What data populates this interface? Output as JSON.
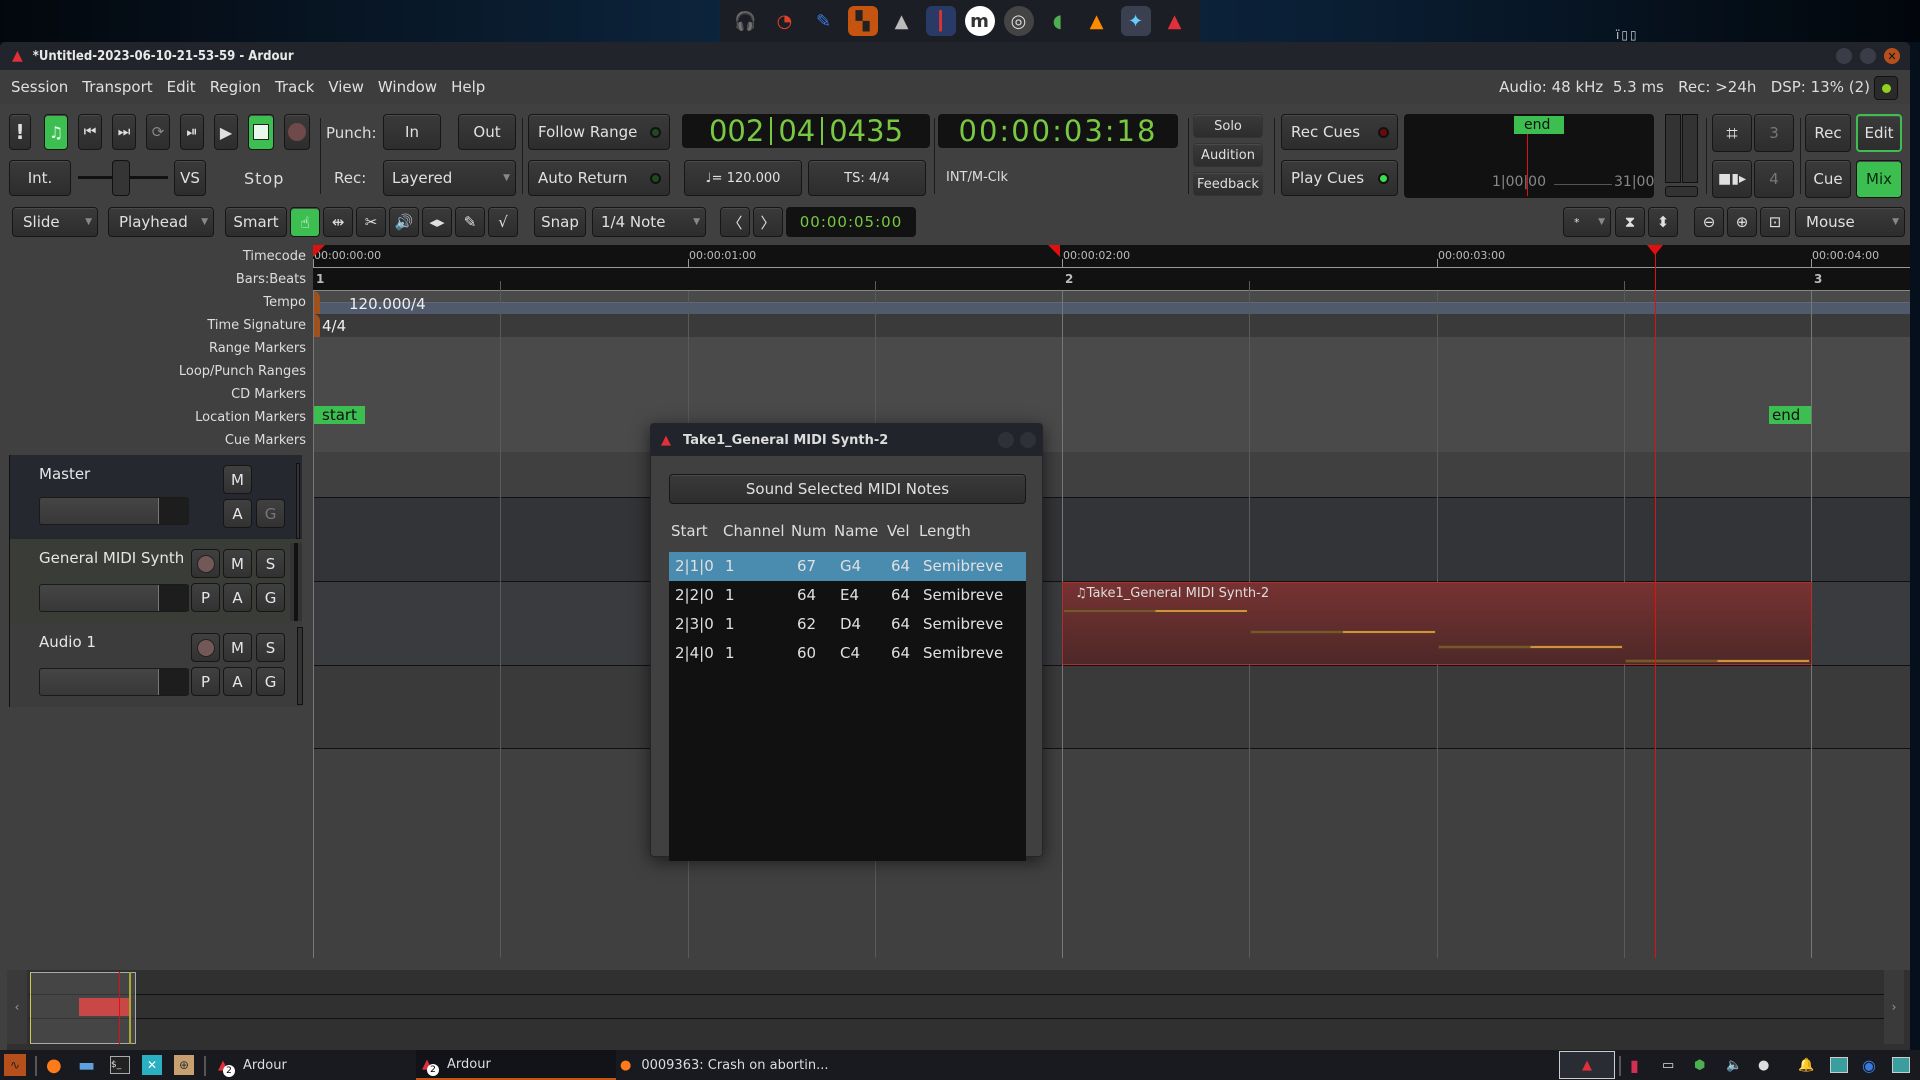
{
  "dock": {
    "apps": [
      "headphones-app",
      "blender",
      "krita",
      "reaper-like",
      "inkscape",
      "sonic-visualiser",
      "musescore",
      "obs",
      "qgis",
      "vlc",
      "davinci-resolve",
      "ardour"
    ]
  },
  "top_tray_text": "ï▯▯",
  "window": {
    "title": "*Untitled-2023-06-10-21-53-59 - Ardour"
  },
  "menu": [
    "Session",
    "Transport",
    "Edit",
    "Region",
    "Track",
    "View",
    "Window",
    "Help"
  ],
  "status": {
    "text_before": "Audio: 48 kHz  5.3 ms   Rec: >24h   DSP: ",
    "dsp": "13%",
    "dsp_suffix": " (2)",
    "full": "Audio: 48 kHz  5.3 ms   Rec: >24h   DSP: 13% (2)"
  },
  "transport": {
    "stop_label": "Stop",
    "int_label": "Int.",
    "vs_label": "VS",
    "punch_label": "Punch:",
    "punch_in": "In",
    "punch_out": "Out",
    "rec_label": "Rec:",
    "rec_mode": "Layered",
    "follow_range": "Follow Range",
    "auto_return": "Auto Return",
    "primary_clock": [
      "002",
      "04",
      "0435"
    ],
    "secondary_clock": "00:00:03:18",
    "tempo": "♩= 120.000",
    "time_signature": "TS: 4/4",
    "sync_source": "INT/M-Clk",
    "solo": "Solo",
    "audition": "Audition",
    "feedback": "Feedback",
    "rec_cues": "Rec Cues",
    "play_cues": "Play Cues",
    "mini_timeline": {
      "marker": "end",
      "left_time": "1|00|00",
      "right_time": "31|00"
    },
    "num3": "3",
    "num4": "4",
    "rec": "Rec",
    "edit": "Edit",
    "cue": "Cue",
    "mix": "Mix"
  },
  "edit_toolbar": {
    "edit_mode": "Slide",
    "edit_point": "Playhead",
    "smart": "Smart",
    "snap": "Snap",
    "grid": "1/4 Note",
    "nudge_clock": "00:00:05:00",
    "visible_tracks": "*",
    "zoom_focus": "Mouse"
  },
  "rulers": {
    "labels": [
      "Timecode",
      "Bars:Beats",
      "Tempo",
      "Time Signature",
      "Range Markers",
      "Loop/Punch Ranges",
      "CD Markers",
      "Location Markers",
      "Cue Markers"
    ],
    "timecode_ticks": [
      "00:00:00:00",
      "00:00:01:00",
      "00:00:02:00",
      "00:00:03:00",
      "00:00:04:00"
    ],
    "bars": [
      "1",
      "2",
      "3"
    ],
    "tempo": "120.000/4",
    "time_signature": "4/4",
    "location_start": "start",
    "location_end": "end"
  },
  "tracks": [
    {
      "name": "Master",
      "buttons": [
        "M",
        "A",
        "G"
      ]
    },
    {
      "name": "General MIDI Synth",
      "buttons": [
        "M",
        "S",
        "P",
        "A",
        "G"
      ]
    },
    {
      "name": "Audio 1",
      "buttons": [
        "M",
        "S",
        "P",
        "A",
        "G"
      ]
    }
  ],
  "region": {
    "name": "♫Take1_General MIDI Synth-2",
    "color": "#7a2e2e"
  },
  "dialog": {
    "title": "Take1_General MIDI Synth-2",
    "sound_button": "Sound Selected MIDI Notes",
    "columns": [
      "Start",
      "Channel",
      "Num",
      "Name",
      "Vel",
      "Length"
    ],
    "rows": [
      [
        "2|1|0",
        "1",
        "67",
        "G4",
        "64",
        "Semibreve"
      ],
      [
        "2|2|0",
        "1",
        "64",
        "E4",
        "64",
        "Semibreve"
      ],
      [
        "2|3|0",
        "1",
        "62",
        "D4",
        "64",
        "Semibreve"
      ],
      [
        "2|4|0",
        "1",
        "60",
        "C4",
        "64",
        "Semibreve"
      ]
    ],
    "selected_row": 0
  },
  "taskbar": {
    "task1": "Ardour",
    "task2": "Ardour",
    "task3": "0009363: Crash on abortin...",
    "badge": "2"
  },
  "colors": {
    "accent_green": "#3cbf50",
    "clock_green": "#78c842",
    "playhead_red": "#e01010",
    "selection_blue": "#4a8cb0",
    "note_orange": "#d49040"
  }
}
